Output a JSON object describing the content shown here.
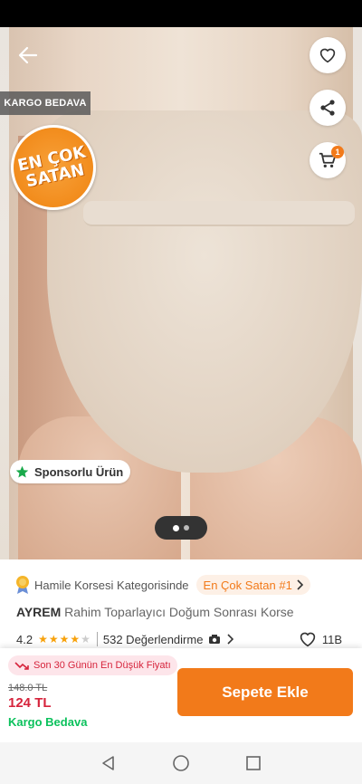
{
  "header": {
    "back_icon": "arrow-left-icon",
    "favorite_icon": "heart-icon",
    "share_icon": "share-icon",
    "cart_icon": "cart-icon",
    "cart_count": "1"
  },
  "gallery": {
    "kargo_tag": "KARGO BEDAVA",
    "bestseller_line1": "EN ÇOK",
    "bestseller_line2": "SATAN",
    "sponsor_label": "Sponsorlu Ürün",
    "page_count": 2,
    "current_page": 1
  },
  "product": {
    "category_text": "Hamile Korsesi Kategorisinde",
    "rank_chip": "En Çok Satan #1",
    "brand": "AYREM",
    "name": "Rahim Toparlayıcı Doğum Sonrası Korse",
    "rating": "4.2",
    "rating_fraction": 0.84,
    "reviews": "532 Değerlendirme",
    "favorites": "11B"
  },
  "price": {
    "lowest_label": "Son 30 Günün En Düşük Fiyatı",
    "old_price": "148.0 TL",
    "new_price": "124 TL",
    "shipping": "Kargo Bedava",
    "add_to_cart": "Sepete Ekle"
  },
  "colors": {
    "accent": "#f27a1a",
    "price_red": "#d6243c",
    "ship_green": "#0bc15c"
  }
}
